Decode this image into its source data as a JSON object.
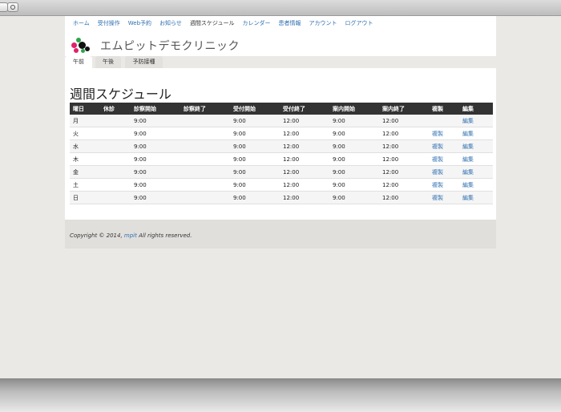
{
  "nav": {
    "items": [
      {
        "label": "ホーム",
        "active": false
      },
      {
        "label": "受付操作",
        "active": false
      },
      {
        "label": "Web予約",
        "active": false
      },
      {
        "label": "お知らせ",
        "active": false
      },
      {
        "label": "週間スケジュール",
        "active": true
      },
      {
        "label": "カレンダー",
        "active": false
      },
      {
        "label": "患者情報",
        "active": false
      },
      {
        "label": "アカウント",
        "active": false
      },
      {
        "label": "ログアウト",
        "active": false
      }
    ]
  },
  "brand": {
    "title": "エムピットデモクリニック"
  },
  "tabs": [
    {
      "label": "午前",
      "active": true
    },
    {
      "label": "午後",
      "active": false
    },
    {
      "label": "予防接種",
      "active": false
    }
  ],
  "schedule": {
    "heading": "週間スケジュール",
    "columns": [
      "曜日",
      "休診",
      "診察開始",
      "診察終了",
      "受付開始",
      "受付終了",
      "案内開始",
      "案内終了",
      "複製",
      "編集"
    ],
    "rows": [
      {
        "day": "月",
        "closed": "",
        "exam_start": "9:00",
        "exam_end": "",
        "reception_start": "9:00",
        "reception_end": "12:00",
        "guide_start": "9:00",
        "guide_end": "12:00",
        "copy": "",
        "edit": "編集"
      },
      {
        "day": "火",
        "closed": "",
        "exam_start": "9:00",
        "exam_end": "",
        "reception_start": "9:00",
        "reception_end": "12:00",
        "guide_start": "9:00",
        "guide_end": "12:00",
        "copy": "複製",
        "edit": "編集"
      },
      {
        "day": "水",
        "closed": "",
        "exam_start": "9:00",
        "exam_end": "",
        "reception_start": "9:00",
        "reception_end": "12:00",
        "guide_start": "9:00",
        "guide_end": "12:00",
        "copy": "複製",
        "edit": "編集"
      },
      {
        "day": "木",
        "closed": "",
        "exam_start": "9:00",
        "exam_end": "",
        "reception_start": "9:00",
        "reception_end": "12:00",
        "guide_start": "9:00",
        "guide_end": "12:00",
        "copy": "複製",
        "edit": "編集"
      },
      {
        "day": "金",
        "closed": "",
        "exam_start": "9:00",
        "exam_end": "",
        "reception_start": "9:00",
        "reception_end": "12:00",
        "guide_start": "9:00",
        "guide_end": "12:00",
        "copy": "複製",
        "edit": "編集"
      },
      {
        "day": "土",
        "closed": "",
        "exam_start": "9:00",
        "exam_end": "",
        "reception_start": "9:00",
        "reception_end": "12:00",
        "guide_start": "9:00",
        "guide_end": "12:00",
        "copy": "複製",
        "edit": "編集"
      },
      {
        "day": "日",
        "closed": "",
        "exam_start": "9:00",
        "exam_end": "",
        "reception_start": "9:00",
        "reception_end": "12:00",
        "guide_start": "9:00",
        "guide_end": "12:00",
        "copy": "複製",
        "edit": "編集"
      }
    ]
  },
  "footer": {
    "prefix": "Copyright © 2014, ",
    "link": "mpit",
    "suffix": " All rights reserved."
  },
  "icons": {
    "logo": "clinic-logo-dots",
    "chrome": "gear-icon"
  },
  "colors": {
    "link": "#2f6fb0",
    "table_header": "#333333",
    "background": "#ebe9e6"
  }
}
